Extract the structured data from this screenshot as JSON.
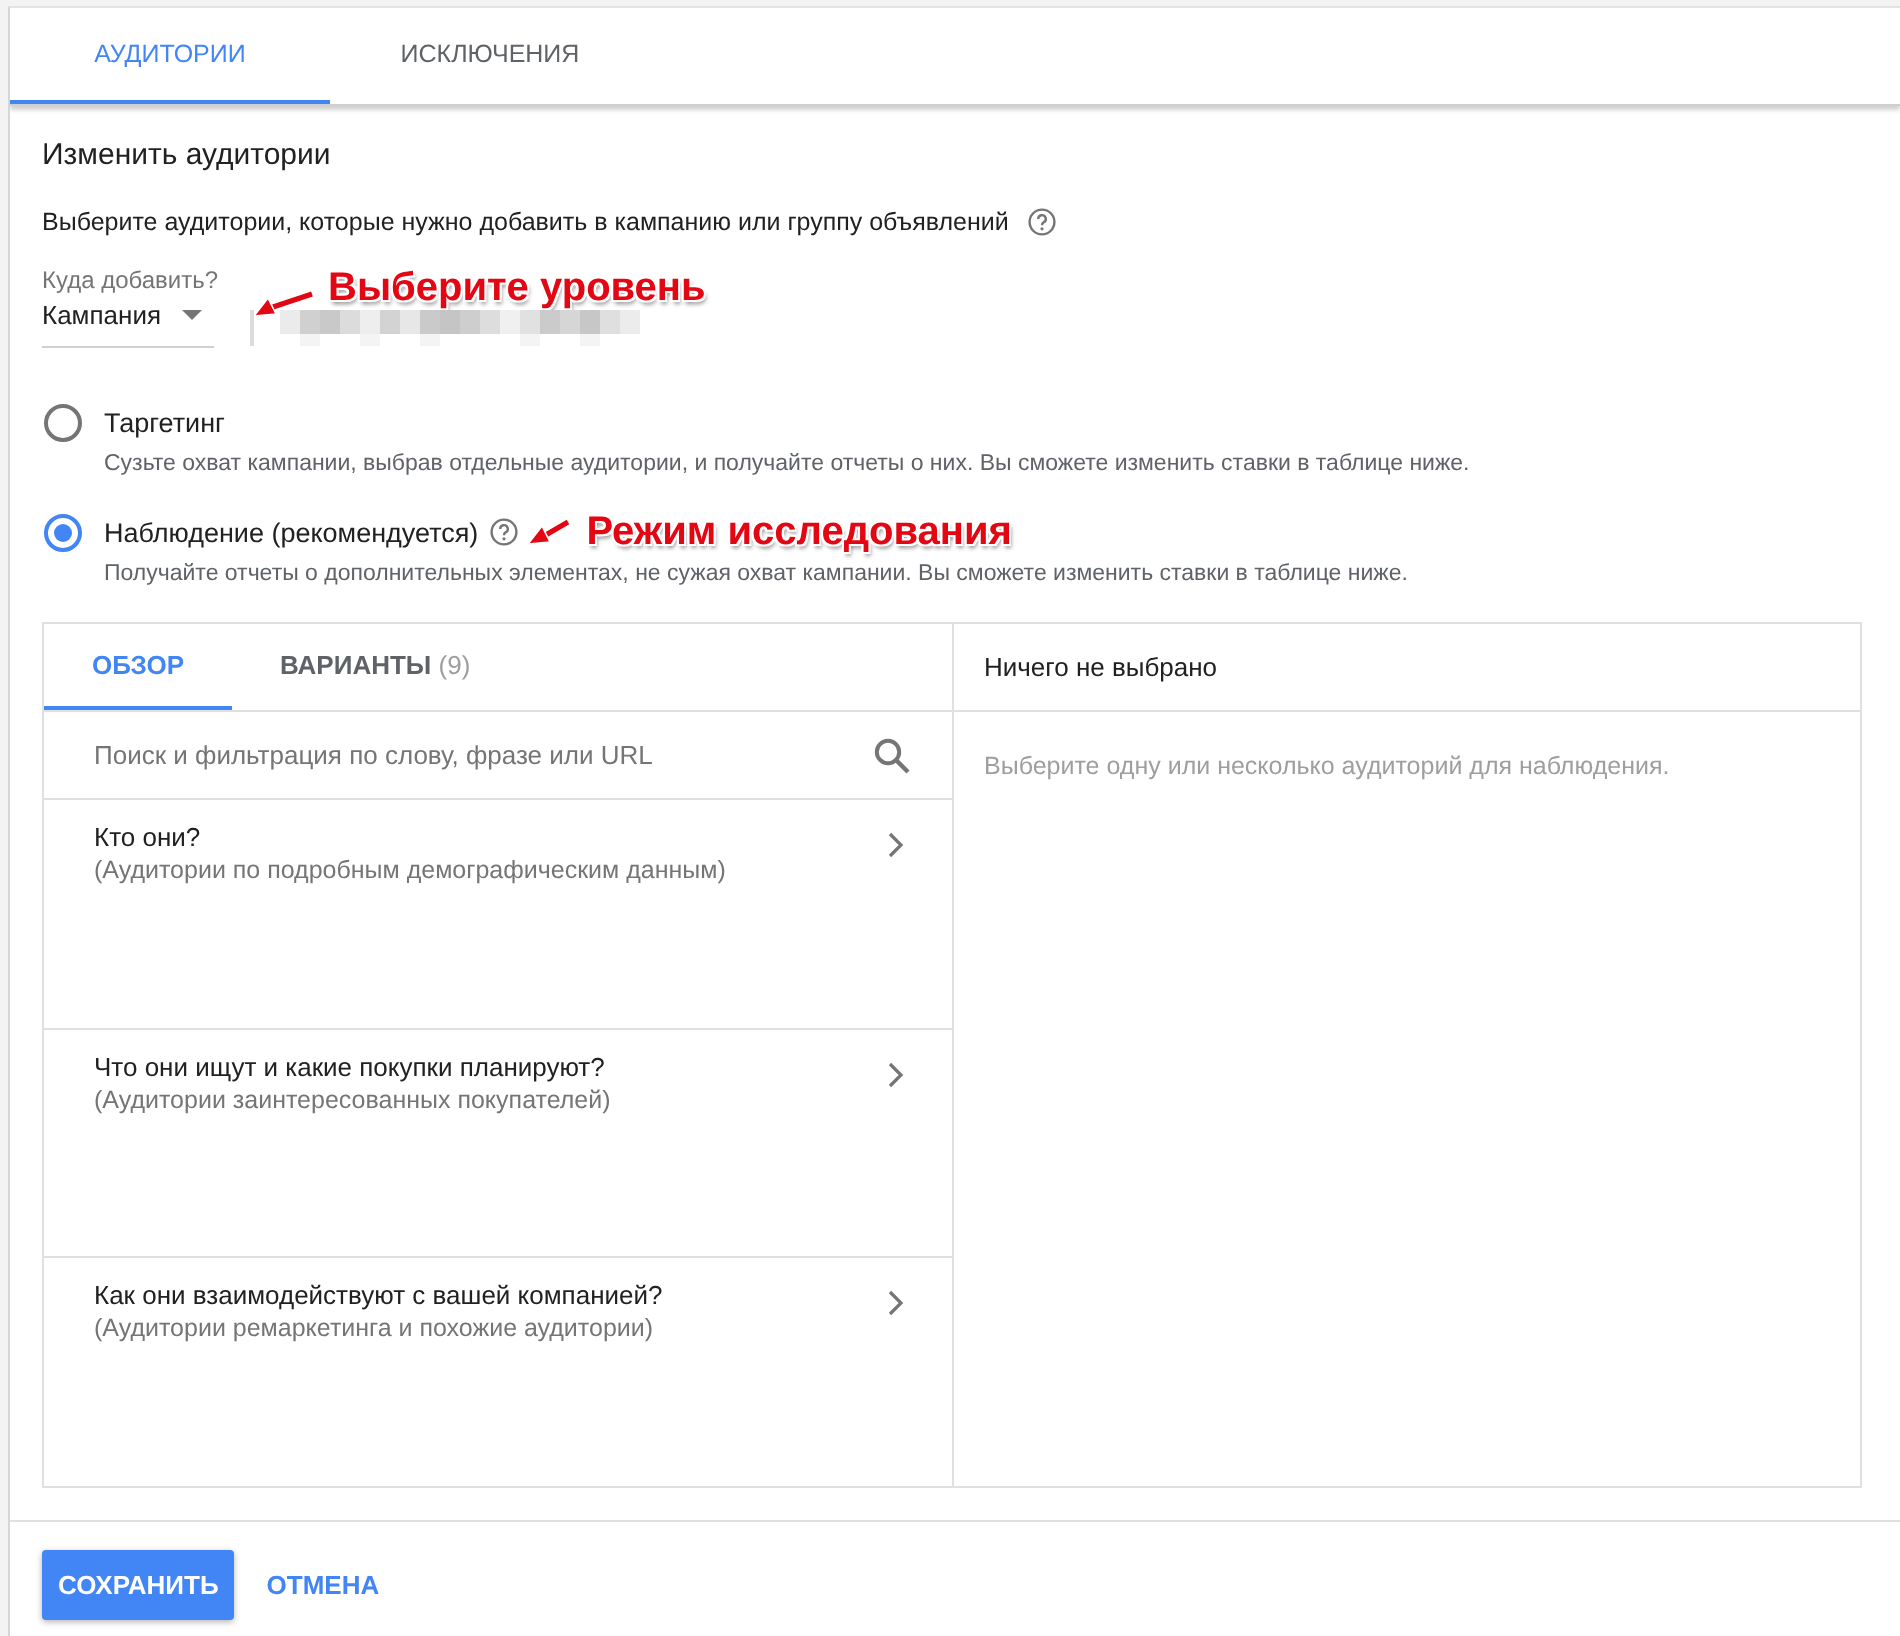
{
  "tabs": [
    {
      "label": "АУДИТОРИИ",
      "selected": true
    },
    {
      "label": "ИСКЛЮЧЕНИЯ",
      "selected": false
    }
  ],
  "heading": "Изменить аудитории",
  "intro": {
    "text": "Выберите аудитории, которые нужно добавить в кампанию или группу объявлений",
    "help": true
  },
  "level_field": {
    "label": "Куда добавить?",
    "value": "Кампания",
    "annotation": "Выберите уровень"
  },
  "radio_options": [
    {
      "label": "Таргетинг",
      "description": "Сузьте охват кампании, выбрав отдельные аудитории, и получайте отчеты о них. Вы сможете изменить ставки в таблице ниже.",
      "selected": false,
      "help": false
    },
    {
      "label": "Наблюдение (рекомендуется)",
      "description": "Получайте отчеты о дополнительных элементах, не сужая охват кампании. Вы сможете изменить ставки в таблице ниже.",
      "selected": true,
      "help": true,
      "annotation": "Режим исследования"
    }
  ],
  "panel": {
    "tabs": [
      {
        "label": "ОБЗОР",
        "selected": true
      },
      {
        "label": "ВАРИАНТЫ",
        "count": "(9)",
        "selected": false
      }
    ],
    "search": {
      "placeholder": "Поиск и фильтрация по слову, фразе или URL"
    },
    "categories": [
      {
        "title": "Кто они?",
        "subtitle": "(Аудитории по подробным демографическим данным)"
      },
      {
        "title": "Что они ищут и какие покупки планируют?",
        "subtitle": "(Аудитории заинтересованных покупателей)"
      },
      {
        "title": "Как они взаимодействуют с вашей компанией?",
        "subtitle": "(Аудитории ремаркетинга и похожие аудитории)"
      }
    ],
    "selection": {
      "title": "Ничего не выбрано",
      "message": "Выберите одну или несколько аудиторий для наблюдения."
    }
  },
  "buttons": [
    {
      "label": "СОХРАНИТЬ",
      "kind": "primary"
    },
    {
      "label": "ОТМЕНА",
      "kind": "link"
    }
  ]
}
